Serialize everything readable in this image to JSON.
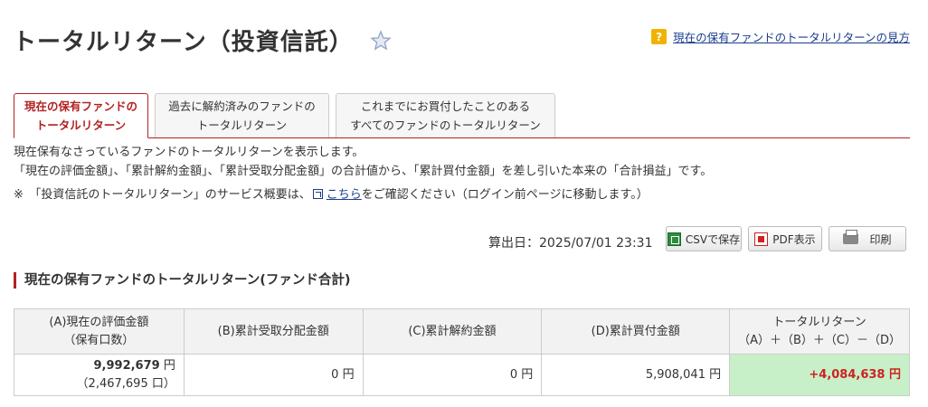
{
  "header": {
    "title": "トータルリターン（投資信託）",
    "help_link": "現在の保有ファンドのトータルリターンの見方",
    "help_icon_text": "?"
  },
  "tabs": [
    {
      "line1": "現在の保有ファンドの",
      "line2": "トータルリターン",
      "active": true
    },
    {
      "line1": "過去に解約済みのファンドの",
      "line2": "トータルリターン",
      "active": false
    },
    {
      "line1": "これまでにお買付したことのある",
      "line2": "すべてのファンドのトータルリターン",
      "active": false
    }
  ],
  "description": {
    "line1": "現在保有なさっているファンドのトータルリターンを表示します。",
    "line2": "「現在の評価金額」、「累計解約金額」、「累計受取分配金額」の合計値から、「累計買付金額」を差し引いた本来の「合計損益」です。",
    "note_prefix": "※　「投資信託のトータルリターン」のサービス概要は、",
    "note_link": "こちら",
    "note_suffix": "をご確認ください（ログイン前ページに移動します。）"
  },
  "toolbar": {
    "date_label": "算出日：2025/07/01 23:31",
    "csv_label": "CSVで保存",
    "pdf_label": "PDF表示",
    "print_label": "印刷"
  },
  "section": {
    "title": "現在の保有ファンドのトータルリターン(ファンド合計)"
  },
  "table": {
    "headers": {
      "a_line1": "(A)現在の評価金額",
      "a_line2": "（保有口数）",
      "b": "(B)累計受取分配金額",
      "c": "(C)累計解約金額",
      "d": "(D)累計買付金額",
      "total_line1": "トータルリターン",
      "total_line2": "（A）＋（B）＋（C）－（D）"
    },
    "row": {
      "a_value": "9,992,679",
      "a_unit": " 円",
      "a_units": "（2,467,695 口）",
      "b": "0 円",
      "c": "0 円",
      "d": "5,908,041 円",
      "total": "+4,084,638 円"
    }
  },
  "colors": {
    "accent": "#b22222",
    "link": "#1a3c8e",
    "total_bg": "#c8f0c8",
    "total_text": "#cc2222"
  }
}
